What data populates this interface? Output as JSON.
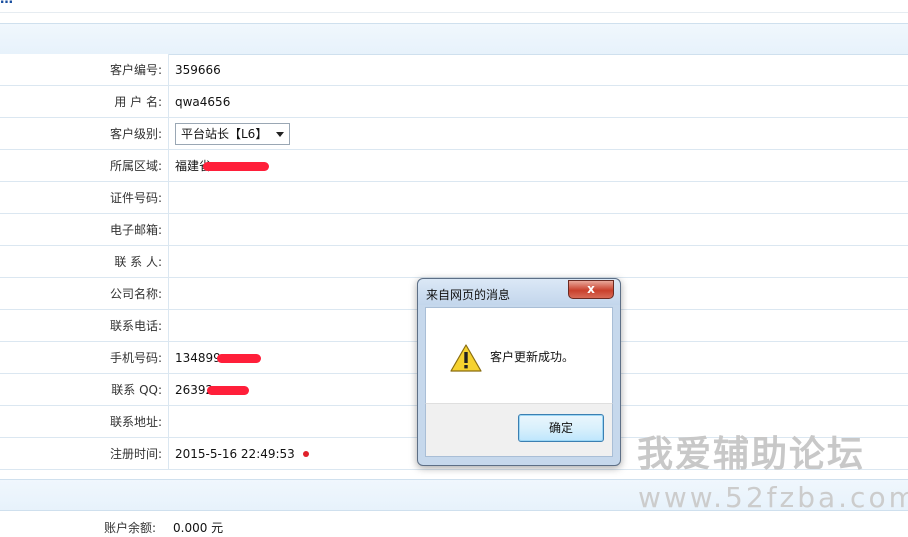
{
  "header": {
    "crumb": "…"
  },
  "form": {
    "customer_id": {
      "label": "客户编号:",
      "value": "359666"
    },
    "username": {
      "label": "用 户 名:",
      "value": "qwa4656"
    },
    "customer_level": {
      "label": "客户级别:",
      "value": "平台站长【L6】"
    },
    "region": {
      "label": "所属区域:",
      "value": "福建省"
    },
    "id_number": {
      "label": "证件号码:",
      "value": ""
    },
    "email": {
      "label": "电子邮箱:",
      "value": ""
    },
    "contact_person": {
      "label": "联 系 人:",
      "value": ""
    },
    "company": {
      "label": "公司名称:",
      "value": ""
    },
    "contact_phone": {
      "label": "联系电话:",
      "value": ""
    },
    "mobile": {
      "label": "手机号码:",
      "value": "134899"
    },
    "qq": {
      "label": "联系 QQ:",
      "value": "26392"
    },
    "address": {
      "label": "联系地址:",
      "value": ""
    },
    "reg_time": {
      "label": "注册时间:",
      "value": "2015-5-16 22:49:53"
    }
  },
  "account": {
    "balance_label": "账户余额:",
    "balance_value": "0.000 元"
  },
  "dialog": {
    "title": "来自网页的消息",
    "close": "x",
    "message": "客户更新成功。",
    "ok_label": "确定"
  },
  "watermark": {
    "line1": "我爱辅助论坛",
    "line2": "www.52fzba.com"
  },
  "colors": {
    "redaction": "#ff1f3a",
    "section_band": "#e7f2fb",
    "row_border": "#dbe7f1"
  }
}
